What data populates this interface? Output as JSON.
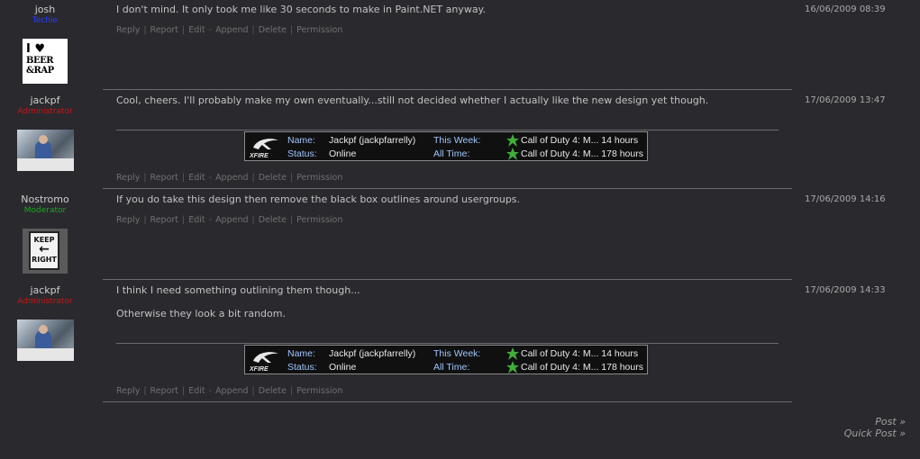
{
  "posts": [
    {
      "user": {
        "name": "josh",
        "role": "Techie",
        "role_color": "#2b3cff",
        "avatar_text": [
          "I ♥",
          "BEER",
          "&RAP"
        ]
      },
      "date": "16/06/2009 08:39",
      "lines": [
        "I don't mind. It only took me like 30 seconds to make in Paint.NET anyway."
      ]
    },
    {
      "user": {
        "name": "jackpf",
        "role": "Administrator",
        "role_color": "#c81515"
      },
      "date": "17/06/2009 13:47",
      "lines": [
        "Cool, cheers. I'll probably make my own eventually...still not decided whether I actually like the new design yet though."
      ]
    },
    {
      "user": {
        "name": "Nostromo",
        "role": "Moderator",
        "role_color": "#1aa81a",
        "avatar_text": [
          "KEEP",
          "←",
          "RIGHT"
        ]
      },
      "date": "17/06/2009 14:16",
      "lines": [
        "If you do take this design then remove the black box outlines around usergroups."
      ]
    },
    {
      "user": {
        "name": "jackpf",
        "role": "Administrator",
        "role_color": "#c81515"
      },
      "date": "17/06/2009 14:33",
      "lines": [
        "I think I need something outlining them though...",
        "Otherwise they look a bit random."
      ]
    }
  ],
  "actions": [
    "Reply",
    "Report",
    "Edit",
    "Append",
    "Delete",
    "Permission"
  ],
  "xfire": {
    "logo_text": "XFIRE",
    "name_label": "Name:",
    "name_value": "Jackpf (jackpfarrelly)",
    "status_label": "Status:",
    "status_value": "Online",
    "week_label": "This Week:",
    "week_value": "Call of Duty 4: M... 14 hours",
    "alltime_label": "All Time:",
    "alltime_value": "Call of Duty 4: M... 178 hours"
  },
  "footer_links": [
    "Post »",
    "Quick Post »"
  ]
}
